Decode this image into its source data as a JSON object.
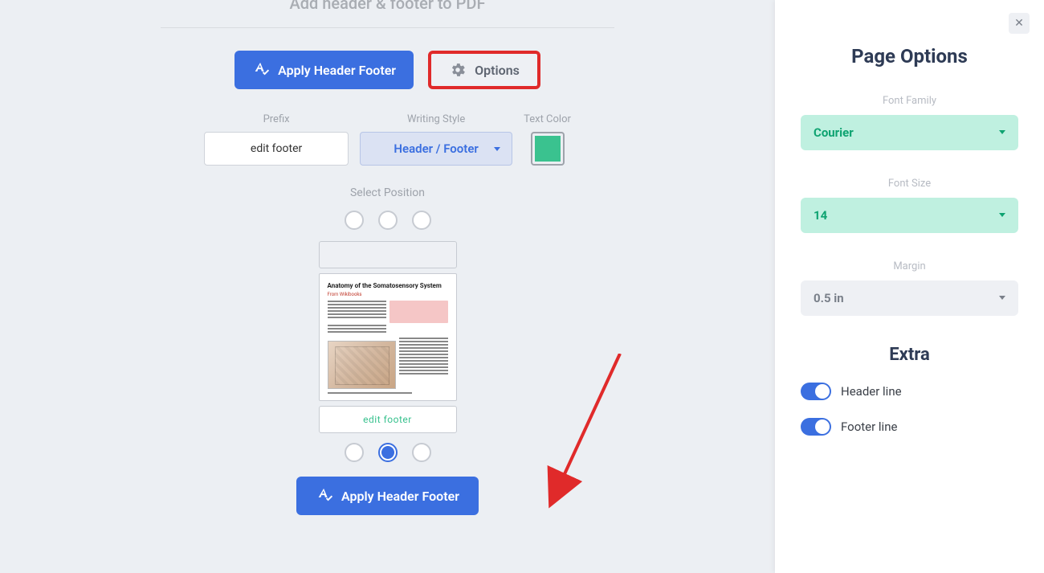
{
  "page_title": "Add header & footer to PDF",
  "tabs": {
    "apply": "Apply Header Footer",
    "options": "Options"
  },
  "config": {
    "prefix_label": "Prefix",
    "prefix_value": "edit footer",
    "style_label": "Writing Style",
    "style_value": "Header / Footer",
    "color_label": "Text Color",
    "color_value": "#3ac28f"
  },
  "select_position_label": "Select Position",
  "preview": {
    "doc_title": "Anatomy of the Somatosensory System",
    "doc_subtitle": "From Wikibooks",
    "footer_text": "edit footer"
  },
  "apply_bottom": "Apply Header Footer",
  "sidebar": {
    "title": "Page Options",
    "font_family_label": "Font Family",
    "font_family_value": "Courier",
    "font_size_label": "Font Size",
    "font_size_value": "14",
    "margin_label": "Margin",
    "margin_value": "0.5 in",
    "extra_title": "Extra",
    "header_line_label": "Header line",
    "footer_line_label": "Footer line"
  }
}
